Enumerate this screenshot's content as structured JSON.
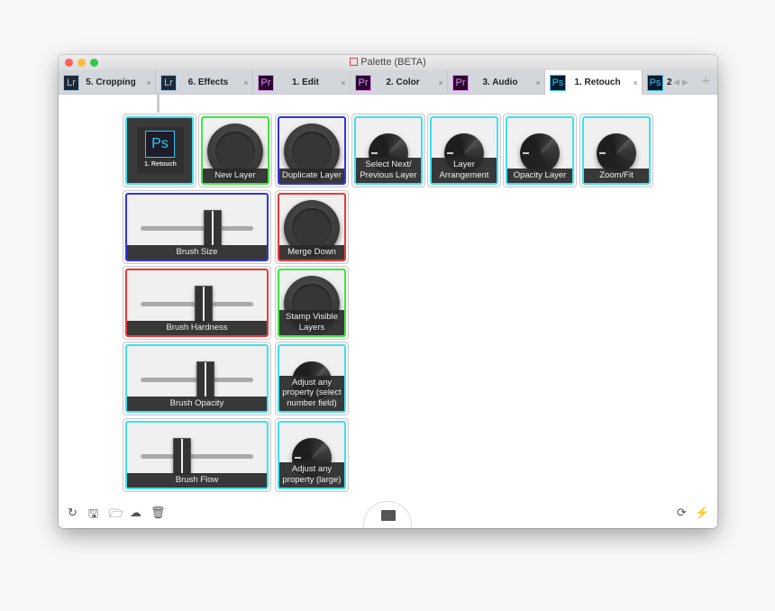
{
  "window": {
    "title": "Palette (BETA)",
    "traffic_lights": [
      "#fc605c",
      "#fdbc40",
      "#34c84a"
    ]
  },
  "tabs": [
    {
      "app": "Lr",
      "label": "5. Cropping",
      "badge_bg": "#1f2a35",
      "badge_fg": "#a8c8e8",
      "active": false
    },
    {
      "app": "Lr",
      "label": "6. Effects",
      "badge_bg": "#1f2a35",
      "badge_fg": "#a8c8e8",
      "active": false
    },
    {
      "app": "Pr",
      "label": "1. Edit",
      "badge_bg": "#2a0a2e",
      "badge_fg": "#e08ef0",
      "active": false
    },
    {
      "app": "Pr",
      "label": "2. Color",
      "badge_bg": "#2a0a2e",
      "badge_fg": "#e08ef0",
      "active": false
    },
    {
      "app": "Pr",
      "label": "3. Audio",
      "badge_bg": "#2a0a2e",
      "badge_fg": "#e08ef0",
      "active": false
    },
    {
      "app": "Ps",
      "label": "1. Retouch",
      "badge_bg": "#0a1a2a",
      "badge_fg": "#31c5f0",
      "active": true
    },
    {
      "app": "Ps",
      "label": "2",
      "badge_bg": "#0a1a2a",
      "badge_fg": "#31c5f0",
      "active": false
    }
  ],
  "tab_close": "×",
  "tab_nav": {
    "prev": "◀",
    "next": "▶",
    "add": "+"
  },
  "colors": {
    "cyan": "#3ee0f0",
    "green": "#3ee83e",
    "blue": "#3434e0",
    "red": "#e83a3a"
  },
  "tiles": [
    {
      "kind": "screen",
      "app": "Ps",
      "label": "1. Retouch",
      "color": "cyan",
      "col": 0,
      "row": 0,
      "span": 1
    },
    {
      "kind": "knob",
      "label": "New Layer",
      "color": "green",
      "col": 1,
      "row": 0,
      "span": 1
    },
    {
      "kind": "knob",
      "label": "Duplicate Layer",
      "color": "blue",
      "col": 2,
      "row": 0,
      "span": 1
    },
    {
      "kind": "dial",
      "label": "Select Next/ Previous Layer",
      "color": "cyan",
      "col": 3,
      "row": 0,
      "span": 1
    },
    {
      "kind": "dial",
      "label": "Layer Arrangement",
      "color": "cyan",
      "col": 4,
      "row": 0,
      "span": 1
    },
    {
      "kind": "dial",
      "label": "Opacity Layer",
      "color": "cyan",
      "col": 5,
      "row": 0,
      "span": 1
    },
    {
      "kind": "dial",
      "label": "Zoom/Fit",
      "color": "cyan",
      "col": 6,
      "row": 0,
      "span": 1
    },
    {
      "kind": "slider",
      "label": "Brush Size",
      "color": "blue",
      "col": 0,
      "row": 1,
      "span": 2,
      "value": 0.67
    },
    {
      "kind": "knob",
      "label": "Merge Down",
      "color": "red",
      "col": 2,
      "row": 1,
      "span": 1
    },
    {
      "kind": "slider",
      "label": "Brush Hardness",
      "color": "red",
      "col": 0,
      "row": 2,
      "span": 2,
      "value": 0.57
    },
    {
      "kind": "knob",
      "label": "Stamp Visible Layers",
      "color": "green",
      "col": 2,
      "row": 2,
      "span": 1
    },
    {
      "kind": "slider",
      "label": "Brush Opacity",
      "color": "cyan",
      "col": 0,
      "row": 3,
      "span": 2,
      "value": 0.59
    },
    {
      "kind": "dial",
      "label": "Adjust any property (select number field)",
      "color": "cyan",
      "col": 2,
      "row": 3,
      "span": 1
    },
    {
      "kind": "slider",
      "label": "Brush Flow",
      "color": "cyan",
      "col": 0,
      "row": 4,
      "span": 2,
      "value": 0.34
    },
    {
      "kind": "dial",
      "label": "Adjust any property (large)",
      "color": "cyan",
      "col": 2,
      "row": 4,
      "span": 1
    }
  ],
  "toolbar": {
    "left_icons": [
      {
        "name": "refresh-icon",
        "glyph": "↻"
      },
      {
        "name": "save-icon",
        "glyph": "🖫"
      },
      {
        "name": "folder-open-icon",
        "glyph": "🗁"
      },
      {
        "name": "cloud-upload-icon",
        "glyph": "☁"
      },
      {
        "name": "trash-icon",
        "glyph": "🗑"
      }
    ],
    "right_icons": [
      {
        "name": "sync-icon",
        "glyph": "⟳"
      },
      {
        "name": "plug-icon",
        "glyph": "⚡"
      }
    ]
  }
}
